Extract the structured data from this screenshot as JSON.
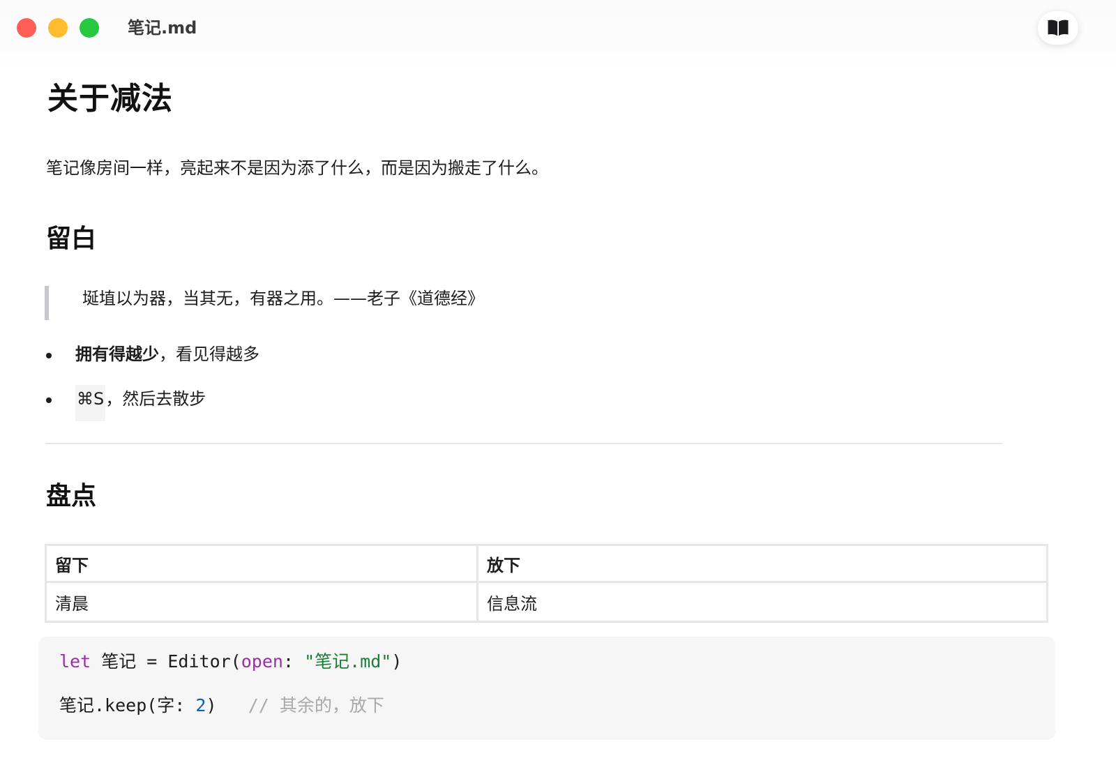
{
  "window": {
    "title": "笔记.md",
    "reader_icon": "open-book-icon"
  },
  "colors": {
    "close": "#ff5f57",
    "minimize": "#febc2e",
    "zoom": "#28c840",
    "keyword": "#9b2ea8",
    "string": "#1a7f37",
    "number": "#0b5fc0",
    "comment": "#a8a8ad"
  },
  "doc": {
    "title": "关于减法",
    "intro": "笔记像房间一样，亮起来不是因为添了什么，而是因为搬走了什么。",
    "section1": {
      "heading": "留白",
      "quote": "埏埴以为器，当其无，有器之用。——老子《道德经》",
      "list": [
        {
          "bold": "拥有得越少",
          "rest": "，看见得越多"
        },
        {
          "code": "⌘S",
          "rest": "，然后去散步"
        }
      ]
    },
    "section2": {
      "heading": "盘点",
      "table": {
        "headers": [
          "留下",
          "放下"
        ],
        "rows": [
          [
            "清晨",
            "信息流"
          ]
        ]
      }
    },
    "code": {
      "line1": {
        "kw": "let",
        "ident": " 笔记 = Editor(",
        "param": "open",
        "colon": ": ",
        "str": "\"笔记.md\"",
        "close": ")"
      },
      "line2": {
        "head": "笔记.keep(字: ",
        "num": "2",
        "close": ")",
        "comment": "// 其余的，放下"
      }
    }
  }
}
